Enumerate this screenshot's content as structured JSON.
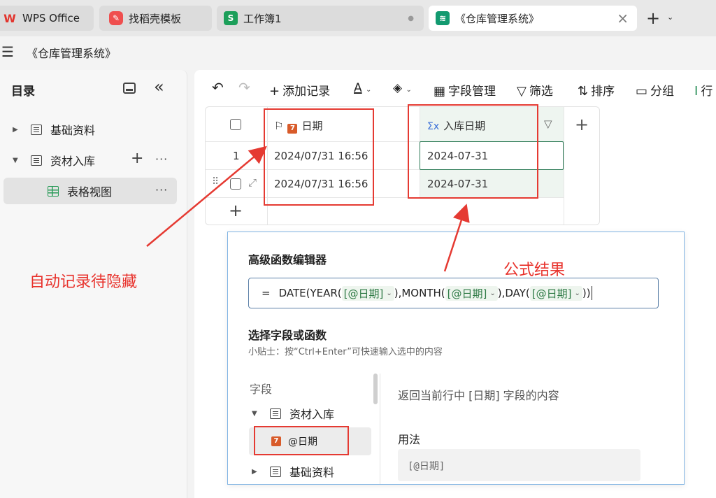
{
  "tabs": [
    {
      "label": "WPS Office",
      "icon": "wps-logo-icon"
    },
    {
      "label": "找稻壳模板",
      "icon": "docer-icon"
    },
    {
      "label": "工作簿1",
      "icon": "spreadsheet-s-icon"
    },
    {
      "label": "《仓库管理系统》",
      "icon": "dbsheet-icon"
    }
  ],
  "new_tab": {
    "icon": "plus-icon"
  },
  "doc_title": "《仓库管理系统》",
  "sidebar": {
    "title": "目录",
    "items": [
      {
        "label": "基础资料",
        "level": 0,
        "expanded": false
      },
      {
        "label": "资材入库",
        "level": 0,
        "expanded": true
      },
      {
        "label": "表格视图",
        "level": 1,
        "selected": true
      }
    ]
  },
  "toolbar": {
    "add_record": "添加记录",
    "field_manage": "字段管理",
    "filter": "筛选",
    "sort": "排序",
    "group": "分组",
    "row_height": "行"
  },
  "table": {
    "columns": [
      "日期",
      "入库日期"
    ],
    "rows": [
      {
        "index": "1",
        "date": "2024/07/31 16:56",
        "inbound": "2024-07-31"
      },
      {
        "index": "",
        "date": "2024/07/31 16:56",
        "inbound": "2024-07-31"
      }
    ]
  },
  "editor": {
    "title": "高级函数编辑器",
    "formula": {
      "eq": "=",
      "p1": "DATE(YEAR(",
      "chip": "[@日期]",
      "p2": "),MONTH(",
      "p3": "),DAY(",
      "p4": "))"
    },
    "select_title": "选择字段或函数",
    "tip": "小贴士：按“Ctrl+Enter”可快速输入选中的内容",
    "field_section": "字段",
    "fields": [
      {
        "label": "资材入库",
        "expanded": true
      },
      {
        "label": "@日期",
        "selected": true
      },
      {
        "label": "基础资料",
        "expanded": false
      }
    ],
    "description": "返回当前行中 [日期] 字段的内容",
    "usage_title": "用法",
    "usage_code": "[@日期]"
  },
  "annotations": {
    "left": "自动记录待隐藏",
    "result": "公式结果"
  },
  "colors": {
    "annotation_red": "#e53a32",
    "accent_green": "#2c7a55",
    "date_icon": "#d85b2a"
  }
}
